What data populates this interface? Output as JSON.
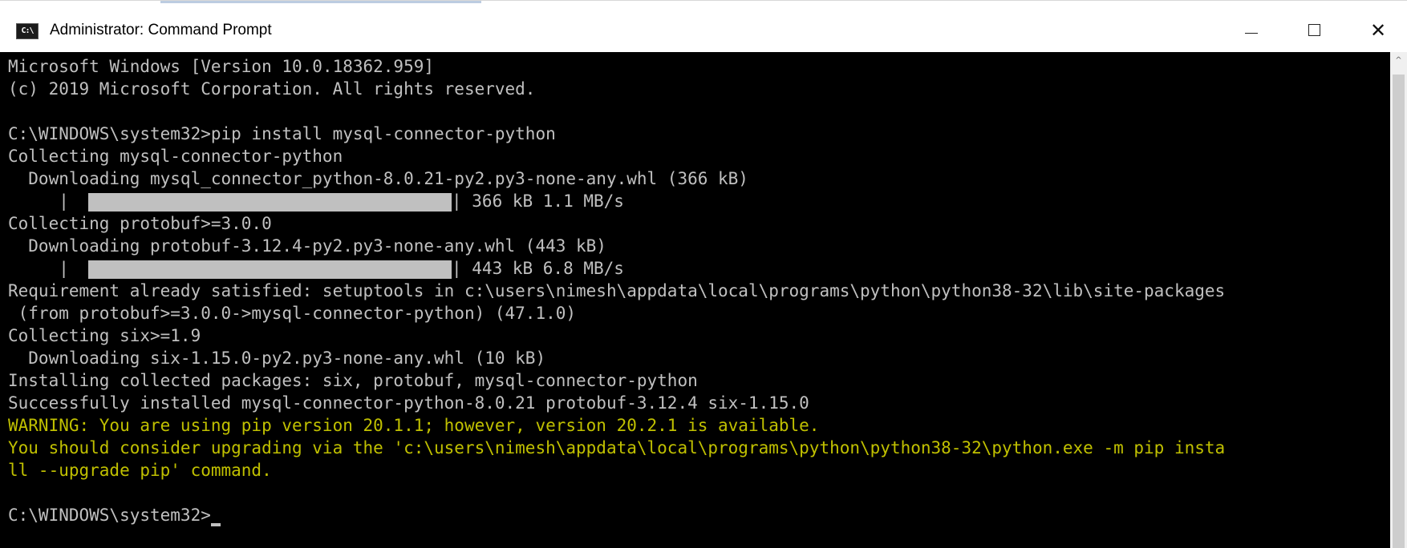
{
  "window": {
    "title": "Administrator: Command Prompt",
    "icon": "cmd-icon",
    "icon_glyph": "C:\\",
    "controls": {
      "minimize": "minimize-icon",
      "maximize": "maximize-icon",
      "close": "close-icon",
      "close_glyph": "✕"
    }
  },
  "console": {
    "background": "#000000",
    "text_color": "#c0c0c0",
    "warning_color": "#c0c000",
    "lines": [
      {
        "text": "Microsoft Windows [Version 10.0.18362.959]"
      },
      {
        "text": "(c) 2019 Microsoft Corporation. All rights reserved."
      },
      {
        "text": ""
      },
      {
        "text": "C:\\WINDOWS\\system32>pip install mysql-connector-python"
      },
      {
        "text": "Collecting mysql-connector-python"
      },
      {
        "text": "  Downloading mysql_connector_python-8.0.21-py2.py3-none-any.whl (366 kB)"
      },
      {
        "progress": {
          "pre": "     |",
          "post": "| 366 kB 1.1 MB/s",
          "fraction": 1.0
        }
      },
      {
        "text": "Collecting protobuf>=3.0.0"
      },
      {
        "text": "  Downloading protobuf-3.12.4-py2.py3-none-any.whl (443 kB)"
      },
      {
        "progress": {
          "pre": "     |",
          "post": "| 443 kB 6.8 MB/s",
          "fraction": 1.0
        }
      },
      {
        "text": "Requirement already satisfied: setuptools in c:\\users\\nimesh\\appdata\\local\\programs\\python\\python38-32\\lib\\site-packages"
      },
      {
        "text": " (from protobuf>=3.0.0->mysql-connector-python) (47.1.0)"
      },
      {
        "text": "Collecting six>=1.9"
      },
      {
        "text": "  Downloading six-1.15.0-py2.py3-none-any.whl (10 kB)"
      },
      {
        "text": "Installing collected packages: six, protobuf, mysql-connector-python"
      },
      {
        "text": "Successfully installed mysql-connector-python-8.0.21 protobuf-3.12.4 six-1.15.0"
      },
      {
        "text": "WARNING: You are using pip version 20.1.1; however, version 20.2.1 is available.",
        "warn": true
      },
      {
        "text": "You should consider upgrading via the 'c:\\users\\nimesh\\appdata\\local\\programs\\python\\python38-32\\python.exe -m pip insta",
        "warn": true
      },
      {
        "text": "ll --upgrade pip' command.",
        "warn": true
      },
      {
        "text": ""
      },
      {
        "text": "C:\\WINDOWS\\system32>",
        "cursor": true
      }
    ]
  },
  "scrollbar": {
    "up_glyph": "^",
    "up_icon": "scroll-up-arrow-icon"
  }
}
